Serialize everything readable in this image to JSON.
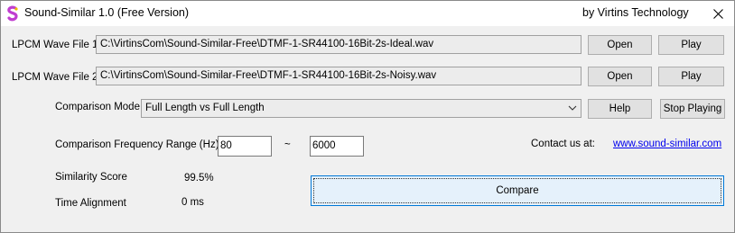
{
  "window": {
    "title": "Sound-Similar 1.0  (Free Version)",
    "company": "by Virtins Technology",
    "icon": "app-logo-icon",
    "close_icon": "close-icon"
  },
  "files": [
    {
      "label": "LPCM Wave File 1",
      "path": "C:\\VirtinsCom\\Sound-Similar-Free\\DTMF-1-SR44100-16Bit-2s-Ideal.wav",
      "open_label": "Open",
      "play_label": "Play"
    },
    {
      "label": "LPCM Wave File 2",
      "path": "C:\\VirtinsCom\\Sound-Similar-Free\\DTMF-1-SR44100-16Bit-2s-Noisy.wav",
      "open_label": "Open",
      "play_label": "Play"
    }
  ],
  "comparison": {
    "mode_label": "Comparison Mode",
    "mode_value": "Full Length vs Full Length",
    "help_label": "Help",
    "stop_label": "Stop Playing",
    "range_label": "Comparison Frequency Range (Hz)",
    "range_low": "80",
    "range_sep": "~",
    "range_high": "6000"
  },
  "contact": {
    "label": "Contact us at:",
    "link": "www.sound-similar.com"
  },
  "results": {
    "score_label": "Similarity Score",
    "score_value": "99.5%",
    "align_label": "Time Alignment",
    "align_value": "0 ms"
  },
  "compare_label": "Compare"
}
